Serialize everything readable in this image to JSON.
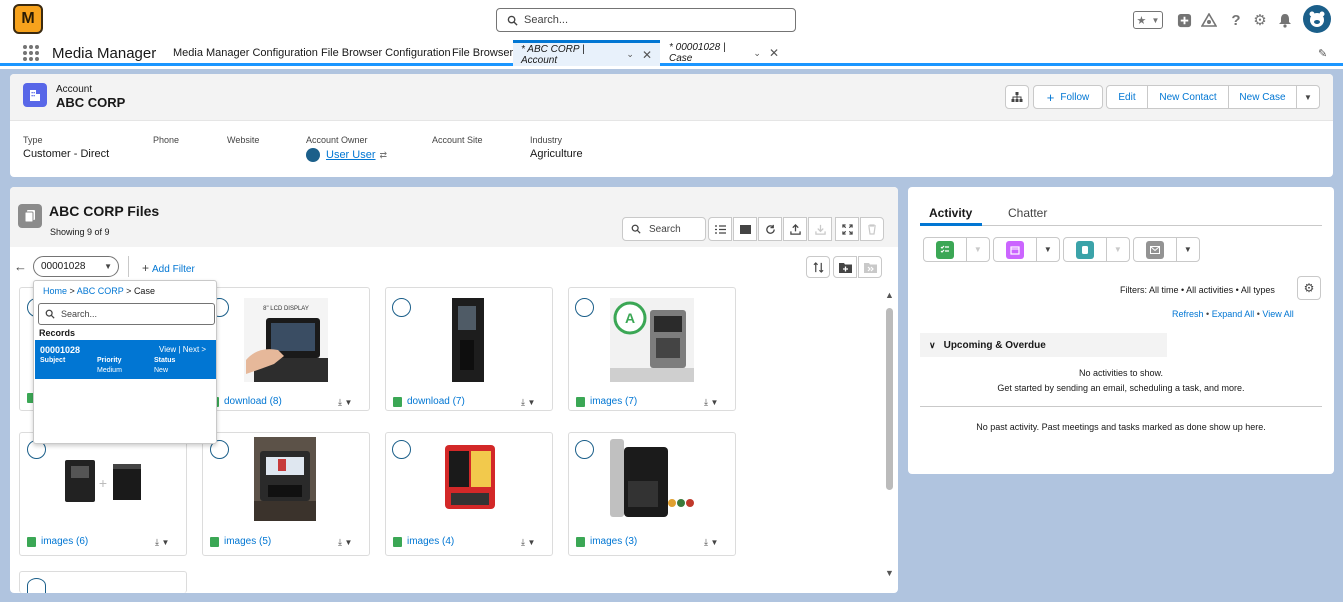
{
  "app": {
    "logo_text": "M",
    "name": "Media Manager"
  },
  "search": {
    "placeholder": "Search..."
  },
  "nav": {
    "items": [
      "Media Manager Configuration",
      "File Browser Configuration",
      "File Browser"
    ],
    "tabs": [
      {
        "label": "* ABC CORP | Account",
        "active": true
      },
      {
        "label": "* 00001028 | Case",
        "active": false
      }
    ]
  },
  "record": {
    "type_label": "Account",
    "name": "ABC CORP",
    "buttons": {
      "follow": "Follow",
      "edit": "Edit",
      "new_contact": "New Contact",
      "new_case": "New Case"
    },
    "fields": [
      {
        "label": "Type",
        "value": "Customer - Direct"
      },
      {
        "label": "Phone",
        "value": ""
      },
      {
        "label": "Website",
        "value": ""
      },
      {
        "label": "Account Owner",
        "value": "User User"
      },
      {
        "label": "Account Site",
        "value": ""
      },
      {
        "label": "Industry",
        "value": "Agriculture"
      }
    ]
  },
  "files": {
    "title": "ABC CORP Files",
    "count": "Showing 9 of 9",
    "search_placeholder": "Search",
    "filter_value": "00001028",
    "add_filter": "Add Filter",
    "items": [
      {
        "name": "download (8)",
        "img": "touch-screen-coffee"
      },
      {
        "name": "download (7)",
        "img": "tall-black-machine"
      },
      {
        "name": "images (7)",
        "img": "silver-espresso-machine"
      },
      {
        "name": "images (6)",
        "img": "two-black-units"
      },
      {
        "name": "images (5)",
        "img": "coffee-in-cafe"
      },
      {
        "name": "images (4)",
        "img": "red-dispenser"
      },
      {
        "name": "images (3)",
        "img": "capsule-machine"
      }
    ]
  },
  "dropdown": {
    "crumbs": [
      "Home",
      "ABC CORP",
      "Case"
    ],
    "search_placeholder": "Search...",
    "records_heading": "Records",
    "record": {
      "number": "00001028",
      "view": "View",
      "next": "Next >",
      "subject_label": "Subject",
      "priority_label": "Priority",
      "priority": "Medium",
      "status_label": "Status",
      "status": "New"
    }
  },
  "activity": {
    "tabs": [
      "Activity",
      "Chatter"
    ],
    "filters": "Filters: All time • All activities • All types",
    "links": [
      "Refresh",
      "Expand All",
      "View All"
    ],
    "upcoming": "Upcoming & Overdue",
    "no_activities": "No activities to show.",
    "get_started": "Get started by sending an email, scheduling a task, and more.",
    "no_past": "No past activity. Past meetings and tasks marked as done show up here."
  },
  "colors": {
    "brand": "#0176d3",
    "bg": "#b0c4df",
    "task": "#3ba755",
    "event": "#cb65ff",
    "call": "#3ba3a9",
    "email": "#939393"
  }
}
